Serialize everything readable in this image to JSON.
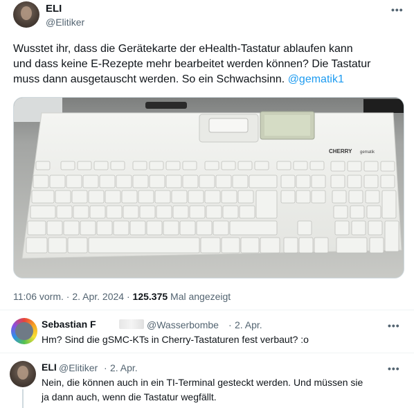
{
  "main_tweet": {
    "author_name": "ELI",
    "author_handle": "@Elitiker",
    "more_label": "•••",
    "text_line1": "Wusstet ihr, dass die Gerätekarte der eHealth-Tastatur ablaufen kann",
    "text_line2": "und dass keine E-Rezepte mehr bearbeitet werden können? Die Tastatur",
    "text_line3": "muss dann ausgetauscht werden. So ein Schwachsinn.",
    "mention": "@gematik1",
    "photo": {
      "brand_label": "CHERRY",
      "device_label": "gematik"
    },
    "time": "11:06 vorm.",
    "separator": "·",
    "date": "2. Apr. 2024",
    "views_count": "125.375",
    "views_label": "Mal angezeigt"
  },
  "replies": [
    {
      "author_name": "Sebastian F",
      "author_handle": "@Wasserbombe",
      "separator": "·",
      "date": "2. Apr.",
      "more_label": "•••",
      "text": "Hm? Sind die gSMC-KTs in Cherry-Tastaturen fest verbaut? :o"
    },
    {
      "author_name": "ELI",
      "author_handle": "@Elitiker",
      "separator": "·",
      "date": "2. Apr.",
      "more_label": "•••",
      "text_line1": "Nein, die können auch in ein TI-Terminal gesteckt werden. Und müssen sie",
      "text_line2": "ja dann auch, wenn die Tastatur wegfällt."
    }
  ],
  "colors": {
    "link": "#1d9bf0",
    "secondary_text": "#536471",
    "primary_text": "#0f1419",
    "divider": "#eff3f4"
  }
}
